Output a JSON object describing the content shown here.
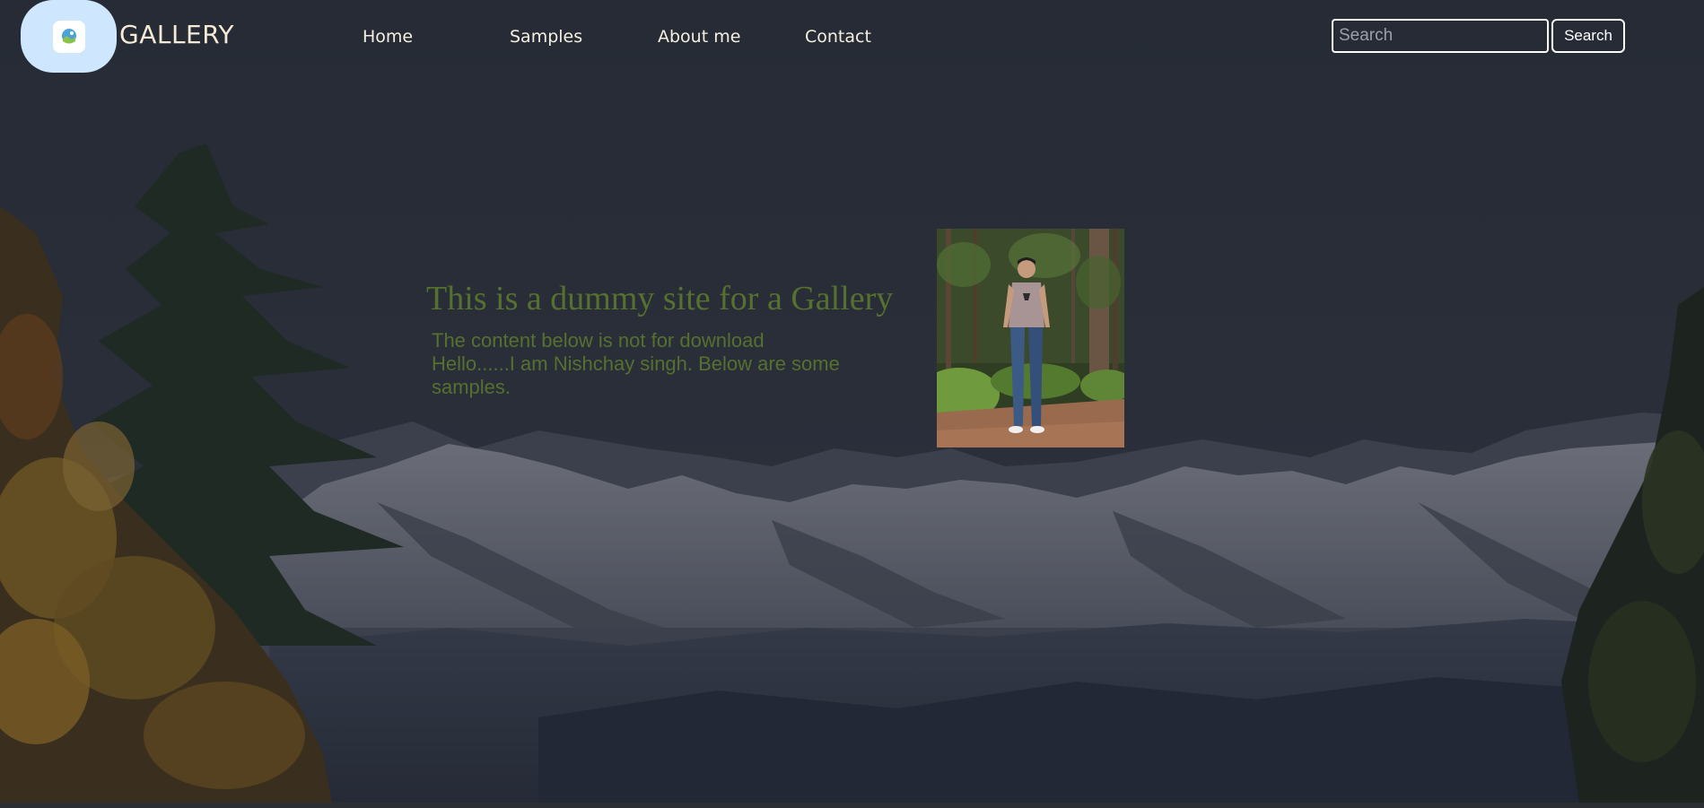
{
  "header": {
    "logo_icon": "gallery-image-icon",
    "brand": "GALLERY",
    "nav": [
      {
        "label": "Home"
      },
      {
        "label": "Samples"
      },
      {
        "label": "About me"
      },
      {
        "label": "Contact"
      }
    ],
    "search": {
      "placeholder": "Search",
      "value": "",
      "button_label": "Search"
    }
  },
  "hero": {
    "title": "This is a dummy site for a Gallery",
    "lines": [
      "The content below is not for download",
      "Hello......I am Nishchay singh. Below are some",
      "samples."
    ]
  },
  "colors": {
    "text_accent": "#56702f",
    "logo_badge": "#cfe6ff",
    "overlay": "#23272f"
  }
}
